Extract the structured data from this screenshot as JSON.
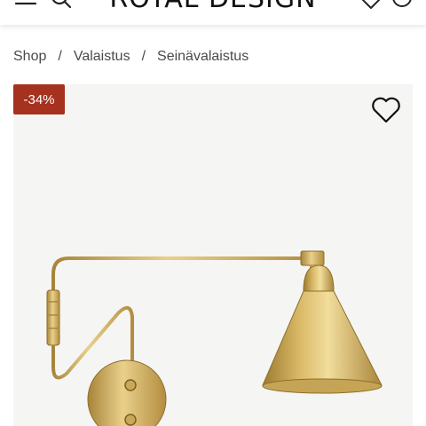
{
  "header": {
    "logo_text": "ROYAL DESIGN",
    "icons": [
      "menu-icon",
      "search-icon",
      "heart-icon",
      "account-icon"
    ]
  },
  "breadcrumb": {
    "items": [
      "Shop",
      "Valaistus",
      "Seinävalaistus"
    ],
    "separator": "/"
  },
  "product": {
    "discount_badge": "-34%",
    "badge_color": "#a5311f",
    "image_background": "#f5f5f4",
    "wishlist_icon": "heart-outline-icon"
  }
}
